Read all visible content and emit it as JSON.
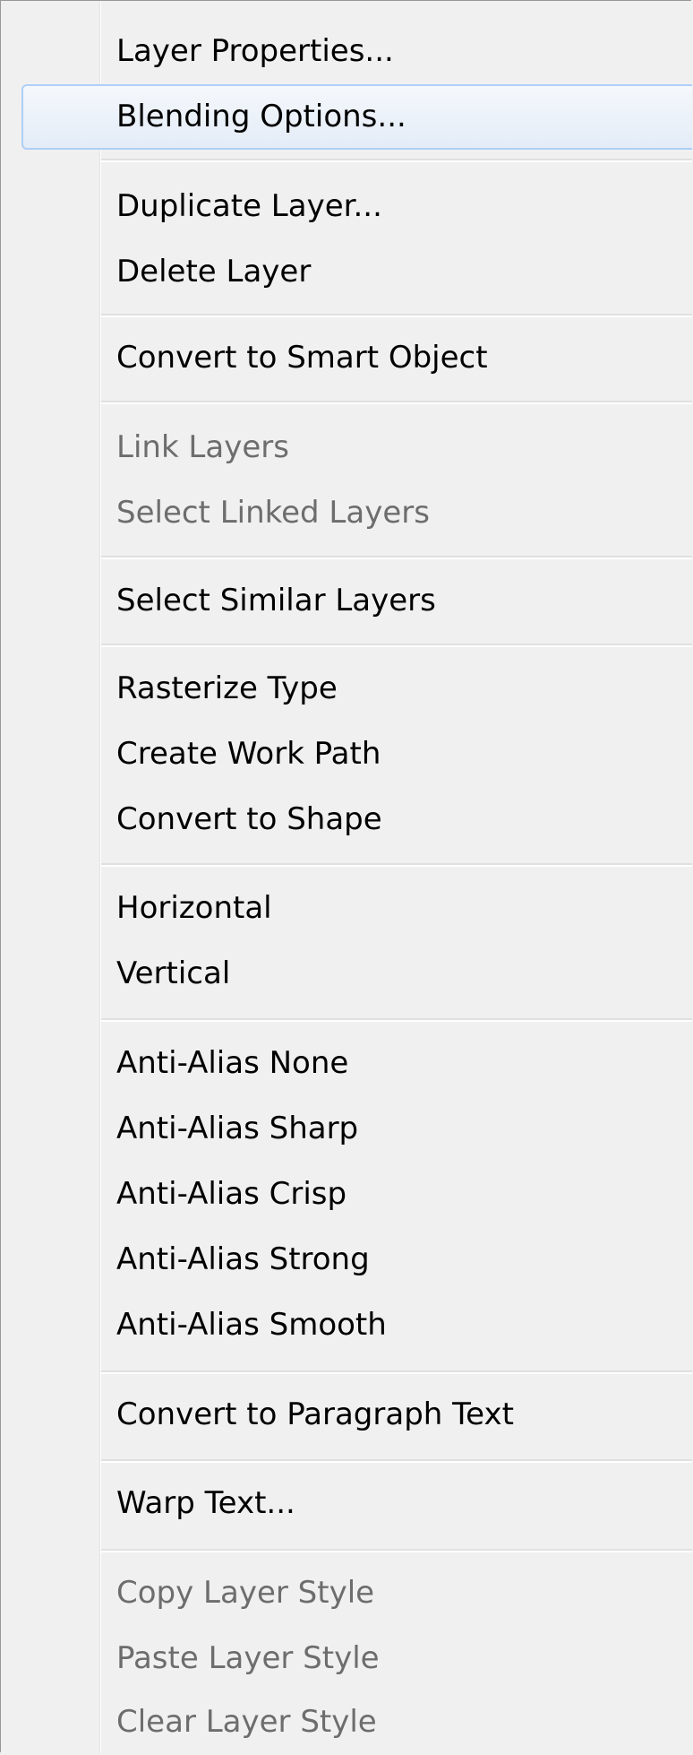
{
  "menu": {
    "items": [
      {
        "label": "Layer Properties...",
        "enabled": true,
        "highlighted": false
      },
      {
        "label": "Blending Options...",
        "enabled": true,
        "highlighted": true
      },
      {
        "label": "Duplicate Layer...",
        "enabled": true,
        "highlighted": false
      },
      {
        "label": "Delete Layer",
        "enabled": true,
        "highlighted": false
      },
      {
        "label": "Convert to Smart Object",
        "enabled": true,
        "highlighted": false
      },
      {
        "label": "Link Layers",
        "enabled": false,
        "highlighted": false
      },
      {
        "label": "Select Linked Layers",
        "enabled": false,
        "highlighted": false
      },
      {
        "label": "Select Similar Layers",
        "enabled": true,
        "highlighted": false
      },
      {
        "label": "Rasterize Type",
        "enabled": true,
        "highlighted": false
      },
      {
        "label": "Create Work Path",
        "enabled": true,
        "highlighted": false
      },
      {
        "label": "Convert to Shape",
        "enabled": true,
        "highlighted": false
      },
      {
        "label": "Horizontal",
        "enabled": true,
        "highlighted": false
      },
      {
        "label": "Vertical",
        "enabled": true,
        "highlighted": false
      },
      {
        "label": "Anti-Alias None",
        "enabled": true,
        "highlighted": false
      },
      {
        "label": "Anti-Alias Sharp",
        "enabled": true,
        "highlighted": false
      },
      {
        "label": "Anti-Alias Crisp",
        "enabled": true,
        "highlighted": false
      },
      {
        "label": "Anti-Alias Strong",
        "enabled": true,
        "highlighted": false
      },
      {
        "label": "Anti-Alias Smooth",
        "enabled": true,
        "highlighted": false
      },
      {
        "label": "Convert to Paragraph Text",
        "enabled": true,
        "highlighted": false
      },
      {
        "label": "Warp Text...",
        "enabled": true,
        "highlighted": false
      },
      {
        "label": "Copy Layer Style",
        "enabled": false,
        "highlighted": false
      },
      {
        "label": "Paste Layer Style",
        "enabled": false,
        "highlighted": false
      },
      {
        "label": "Clear Layer Style",
        "enabled": false,
        "highlighted": false
      }
    ]
  },
  "colors": {
    "menu_background": "#f0f0f0",
    "text_enabled": "#000000",
    "text_disabled": "#6d6d6d",
    "highlight_border": "#aecff7",
    "highlight_fill": "#e3ecf7"
  }
}
